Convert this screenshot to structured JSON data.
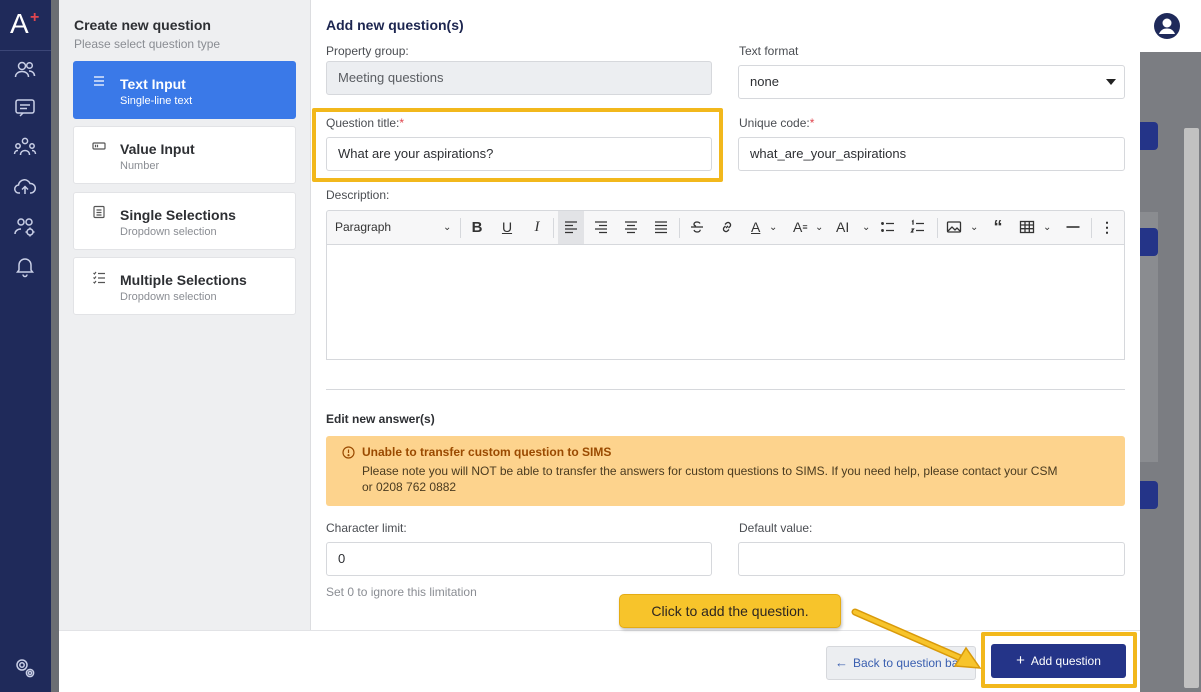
{
  "rail": {
    "logo": "A",
    "logo_plus": "+",
    "items": [
      "users-icon",
      "messages-icon",
      "groups-icon",
      "upload-cloud-icon",
      "group-settings-icon",
      "bell-icon"
    ],
    "bottom": "settings-icon"
  },
  "left": {
    "title": "Create new question",
    "subtitle": "Please select question type",
    "types": [
      {
        "title": "Text Input",
        "sub": "Single-line text",
        "icon": "text-lines-icon"
      },
      {
        "title": "Value Input",
        "sub": "Number",
        "icon": "input-field-icon"
      },
      {
        "title": "Single Selections",
        "sub": "Dropdown selection",
        "icon": "list-icon"
      },
      {
        "title": "Multiple Selections",
        "sub": "Dropdown selection",
        "icon": "checklist-icon"
      }
    ]
  },
  "form": {
    "heading": "Add new question(s)",
    "property_group_label": "Property group:",
    "property_group_value": "Meeting questions",
    "text_format_label": "Text format",
    "text_format_value": "none",
    "question_title_label": "Question title:",
    "question_title_value": "What are your aspirations?",
    "unique_code_label": "Unique code:",
    "unique_code_value": "what_are_your_aspirations",
    "required_mark": "*",
    "description_label": "Description:",
    "editor_paragraph": "Paragraph",
    "answers_heading": "Edit new answer(s)",
    "warning_title": "Unable to transfer custom question to SIMS",
    "warning_message": "Please note you will NOT be able to transfer the answers for custom questions to SIMS. If you need help, please contact your CSM or 0208 762 0882",
    "char_limit_label": "Character limit:",
    "char_limit_value": "0",
    "default_value_label": "Default value:",
    "default_value_value": "",
    "char_limit_hint": "Set 0 to ignore this limitation"
  },
  "footer": {
    "back_label": "Back to question bank",
    "add_label": "Add question",
    "back_arrow": "←",
    "add_plus": "+"
  },
  "callout": {
    "text": "Click to add the question."
  },
  "colors": {
    "rail": "#1f2a5a",
    "active": "#3a79e8",
    "primary": "#243488",
    "highlight": "#f2b81c",
    "warning_bg": "#fdd38d"
  }
}
